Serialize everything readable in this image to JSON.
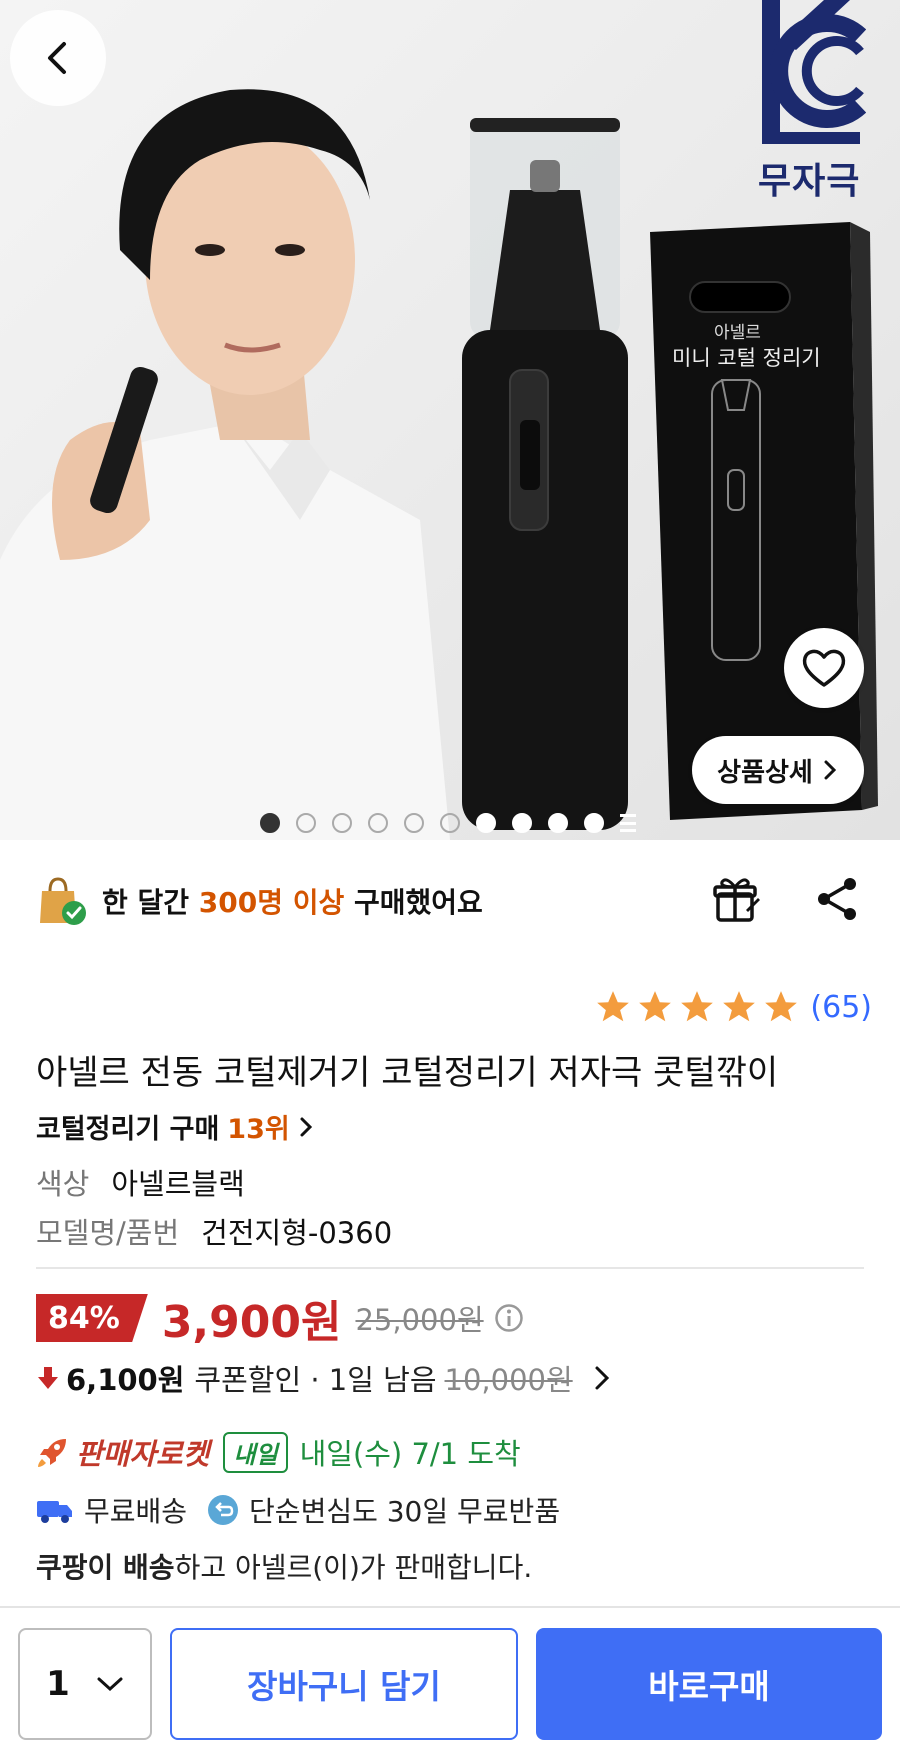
{
  "hero": {
    "kc_label": "무자극",
    "box_brand": "아넬르",
    "box_product_name": "미니 코털 정리기",
    "detail_button_label": "상품상세",
    "image_count": 10,
    "active_image_index": 0
  },
  "purchase_info": {
    "prefix": "한 달간 ",
    "highlight": "300명 이상",
    "suffix": " 구매했어요"
  },
  "rating": {
    "stars": 5,
    "count_text": "(65)"
  },
  "product": {
    "title": "아넬르 전동 코털제거기 코털정리기 저자극 콧털깎이",
    "rank_prefix": "코털정리기 구매",
    "rank_value": "13위",
    "options": [
      {
        "label": "색상",
        "value": "아넬르블랙"
      },
      {
        "label": "모델명/품번",
        "value": "건전지형-0360"
      }
    ]
  },
  "price": {
    "discount": "84%",
    "sale_price": "3,900원",
    "original_price": "25,000원"
  },
  "coupon": {
    "amount": "6,100원",
    "text": "쿠폰할인 · 1일 남음",
    "original": "10,000원"
  },
  "delivery": {
    "rocket_label": "판매자로켓",
    "badge": "내일",
    "arrival": "내일(수) 7/1 도착",
    "free_shipping": "무료배송",
    "free_return": "단순변심도 30일 무료반품",
    "seller_prefix": "쿠팡이 배송",
    "seller_suffix": "하고 아넬르(이)가 판매합니다."
  },
  "bottom_bar": {
    "quantity": "1",
    "cart_label": "장바구니 담기",
    "buy_label": "바로구매"
  },
  "colors": {
    "accent_blue": "#3f6ef5",
    "sale_red": "#c62828",
    "highlight_orange": "#d35400",
    "rocket_green": "#1e8e3e",
    "star_orange": "#f39c3d"
  }
}
